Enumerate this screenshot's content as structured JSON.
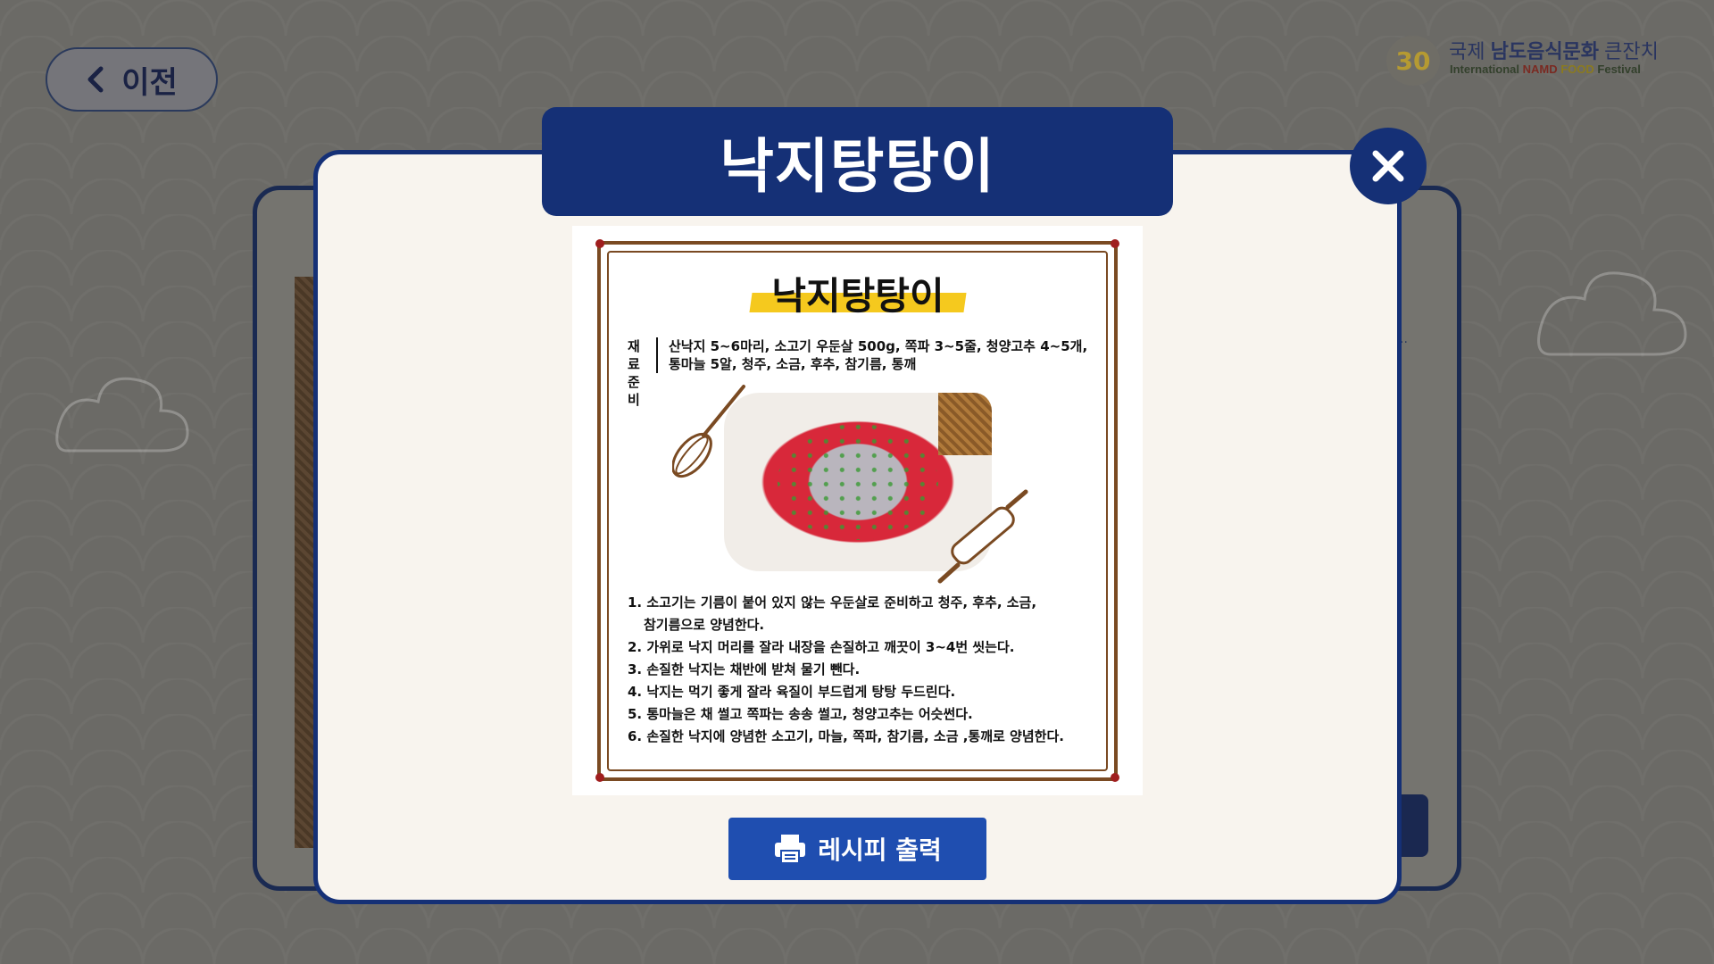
{
  "header": {
    "back_label": "이전",
    "logo": {
      "mark": "30",
      "ko_prefix": "국제 ",
      "ko_bold": "남도음식문화",
      "ko_suffix": " 큰잔치",
      "en_prefix": "International ",
      "en_red": "NAMD",
      "en_yellow": " FOOD",
      "en_suffix": " Festival"
    }
  },
  "modal": {
    "title": "낙지탕탕이",
    "close_label": "X",
    "print_label": "레시피 출력"
  },
  "recipe_card": {
    "title": "낙지탕탕이",
    "ingredients_label": "재료\n준비",
    "ingredients_line1": "산낙지 5~6마리, 소고기 우둔살 500g, 쪽파 3~5줄, 청양고추 4~5개,",
    "ingredients_line2": "통마늘 5알, 청주, 소금, 후추, 참기름, 통깨",
    "steps": [
      "1. 소고기는 기름이 붙어 있지 않는 우둔살로 준비하고 청주, 후추, 소금,",
      "참기름으로 양념한다.",
      "2. 가위로 낙지 머리를 잘라 내장을 손질하고 깨끗이 3~4번 씻는다.",
      "3. 손질한 낙지는 채반에 받쳐 물기 뺀다.",
      "4. 낙지는 먹기 좋게 잘라 육질이 부드럽게 탕탕 두드린다.",
      "5. 통마늘은 채 썰고 쪽파는 송송 썰고, 청양고추는 어슷썬다.",
      "6. 손질한 낙지에 양념한 소고기, 마늘, 쪽파, 참기름, 소금 ,통깨로 양념한다."
    ]
  },
  "colors": {
    "navy": "#153076",
    "print_blue": "#1f4eb0",
    "modal_bg": "#f8f4ee",
    "highlight": "#f5c91e"
  }
}
